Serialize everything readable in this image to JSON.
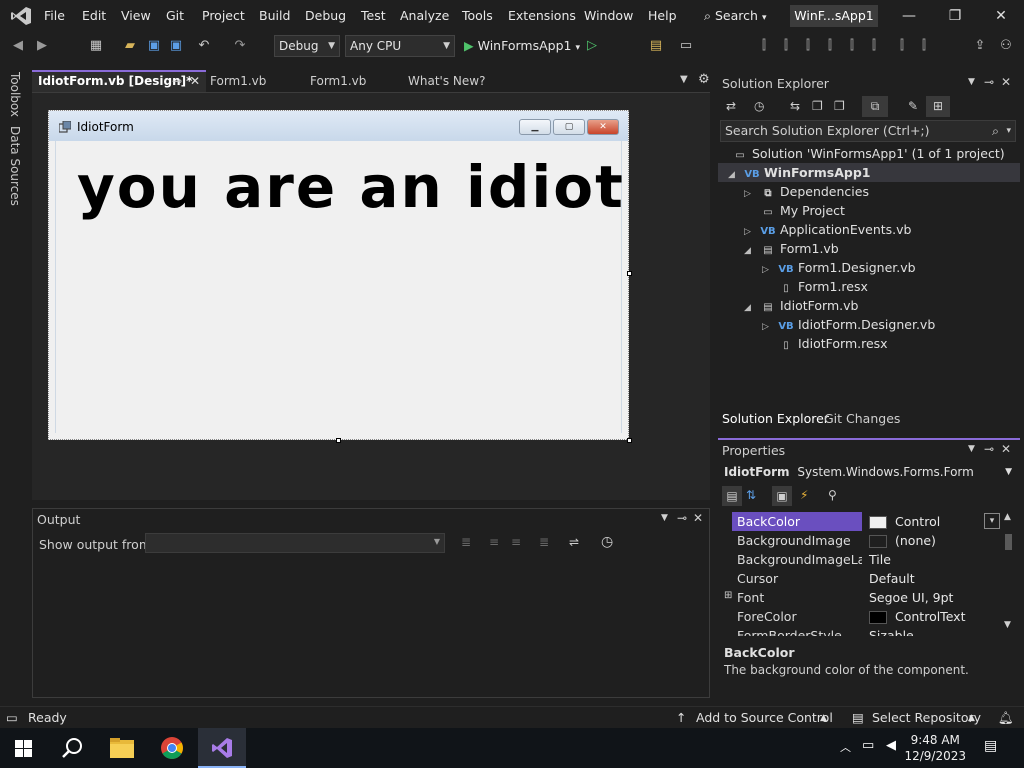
{
  "titlebar": {
    "menu": [
      "File",
      "Edit",
      "View",
      "Git",
      "Project",
      "Build",
      "Debug",
      "Test",
      "Analyze",
      "Tools",
      "Extensions",
      "Window",
      "Help"
    ],
    "search_label": "Search",
    "solution_badge": "WinF...sApp1"
  },
  "toolbar": {
    "config": "Debug",
    "platform": "Any CPU",
    "run_label": "WinFormsApp1"
  },
  "left_strip": {
    "toolbox": "Toolbox",
    "data_sources": "Data Sources"
  },
  "doc_tabs": [
    {
      "label": "IdiotForm.vb [Design]*"
    },
    {
      "label": "Form1.vb"
    },
    {
      "label": "Form1.vb"
    },
    {
      "label": "What's New?"
    }
  ],
  "designer": {
    "form_title": "IdiotForm",
    "label_text": "you are an idiot"
  },
  "output": {
    "title": "Output",
    "show_from": "Show output from:"
  },
  "solution_explorer": {
    "title": "Solution Explorer",
    "search_placeholder": "Search Solution Explorer (Ctrl+;)",
    "items": [
      {
        "label": "Solution 'WinFormsApp1' (1 of 1 project)"
      },
      {
        "label": "WinFormsApp1"
      },
      {
        "label": "Dependencies"
      },
      {
        "label": "My Project"
      },
      {
        "label": "ApplicationEvents.vb"
      },
      {
        "label": "Form1.vb"
      },
      {
        "label": "Form1.Designer.vb"
      },
      {
        "label": "Form1.resx"
      },
      {
        "label": "IdiotForm.vb"
      },
      {
        "label": "IdiotForm.Designer.vb"
      },
      {
        "label": "IdiotForm.resx"
      }
    ],
    "bottom_tabs": [
      "Solution Explorer",
      "Git Changes"
    ]
  },
  "properties": {
    "title": "Properties",
    "object_name": "IdiotForm",
    "object_type": "System.Windows.Forms.Form",
    "rows": [
      {
        "name": "BackColor",
        "value": "Control",
        "swatch": "#f0f0f0"
      },
      {
        "name": "BackgroundImage",
        "value": "(none)",
        "swatch": "#1f1f1f"
      },
      {
        "name": "BackgroundImageLayout",
        "value": "Tile"
      },
      {
        "name": "Cursor",
        "value": "Default"
      },
      {
        "name": "Font",
        "value": "Segoe UI, 9pt"
      },
      {
        "name": "ForeColor",
        "value": "ControlText",
        "swatch": "#000000"
      },
      {
        "name": "FormBorderStyle",
        "value": "Sizable"
      }
    ],
    "desc_title": "BackColor",
    "desc_text": "The background color of the component."
  },
  "statusbar": {
    "ready": "Ready",
    "add_source": "Add to Source Control",
    "select_repo": "Select Repository"
  },
  "taskbar": {
    "time": "9:48 AM",
    "date": "12/9/2023"
  },
  "colors": {
    "accent": "#8a6bd8",
    "selection": "#6a4fbf"
  }
}
